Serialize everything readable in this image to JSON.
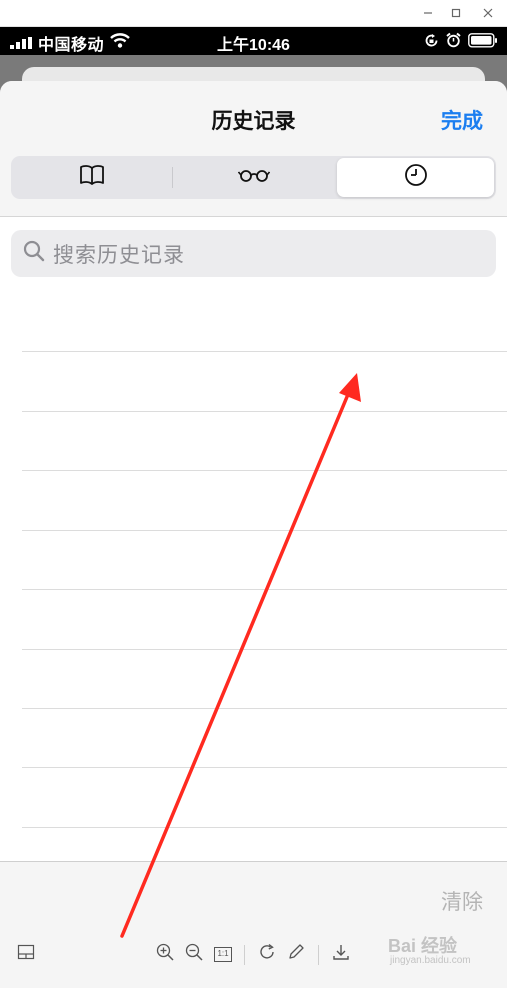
{
  "window_controls": [
    {
      "name": "minimize",
      "icon": "minimize-icon"
    },
    {
      "name": "maximize",
      "icon": "maximize-icon"
    },
    {
      "name": "close",
      "icon": "close-icon"
    }
  ],
  "status_bar": {
    "carrier": "中国移动",
    "time": "上午10:46",
    "icons": [
      "signal-icon",
      "wifi-icon",
      "rotation-lock-icon",
      "alarm-icon",
      "battery-icon"
    ]
  },
  "sheet": {
    "title": "历史记录",
    "done_label": "完成",
    "done_color": "#1b7ef0",
    "segments": [
      {
        "icon": "book-icon",
        "selected": false
      },
      {
        "icon": "glasses-icon",
        "selected": false
      },
      {
        "icon": "clock-icon",
        "selected": true
      }
    ],
    "search": {
      "placeholder": "搜索历史记录",
      "icon": "search-icon"
    },
    "clear_label": "清除"
  },
  "viewer_toolbar": {
    "icons": [
      "layout-icon",
      "zoom-in-icon",
      "zoom-out-icon",
      "actual-size-icon",
      "rotate-icon",
      "edit-icon",
      "download-icon"
    ],
    "actual_size_label": "1:1"
  },
  "watermark": {
    "text": "Bai 经验",
    "sub": "jingyan.baidu.com"
  },
  "annotation": {
    "color": "#ff2a20",
    "icon": "red-arrow"
  }
}
